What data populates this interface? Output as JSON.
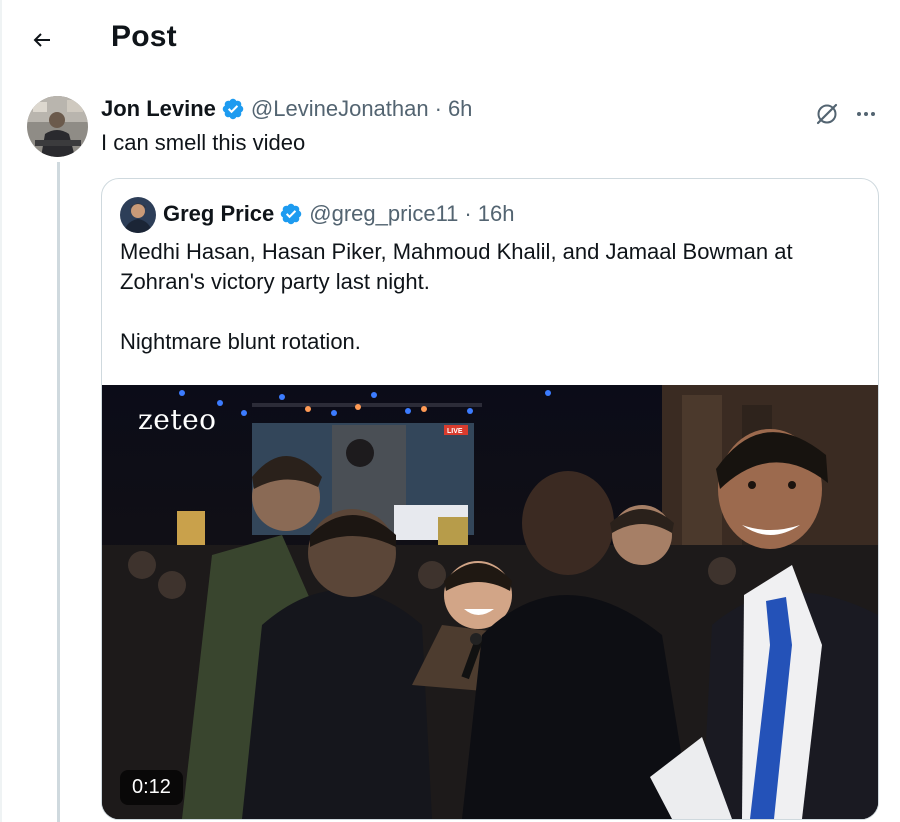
{
  "header": {
    "back_icon": "arrow-left-icon",
    "title": "Post"
  },
  "tweet": {
    "author_name": "Jon Levine",
    "handle": "@LevineJonathan",
    "separator": "·",
    "time": "6h",
    "text": "I can smell this video",
    "verified_icon": "verified-badge-icon",
    "grok_icon": "grok-icon",
    "more_icon": "more-horizontal-icon"
  },
  "quote": {
    "author_name": "Greg Price",
    "handle": "@greg_price11",
    "separator": "·",
    "time": "16h",
    "text_line1": "Medhi Hasan, Hasan Piker, Mahmoud Khalil, and Jamaal Bowman at Zohran's victory party last night.",
    "text_line2": "Nightmare blunt rotation.",
    "video": {
      "watermark": "zeteo",
      "screen_badge": "LIVE",
      "duration": "0:12"
    }
  },
  "colors": {
    "text_primary": "#0f1419",
    "text_secondary": "#536471",
    "border": "#cfd9de",
    "verified_blue": "#1d9bf0"
  }
}
